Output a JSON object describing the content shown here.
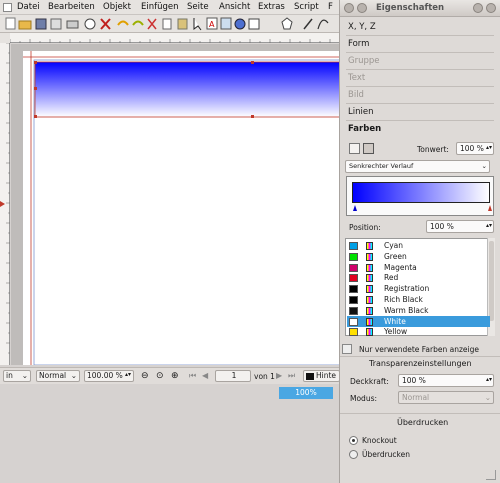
{
  "menu": {
    "items": [
      "Datei",
      "Bearbeiten",
      "Objekt",
      "Einfügen",
      "Seite",
      "Ansicht",
      "Extras",
      "Script",
      "F"
    ]
  },
  "bottom": {
    "unit": "in",
    "mode": "Normal",
    "zoom": "100.00 %",
    "page": "1",
    "of_pages": "von 1",
    "layer": "Hinte",
    "zoom_badge": "100%"
  },
  "panel": {
    "title": "Eigenschaften",
    "sections": {
      "xyz": "X, Y, Z",
      "form": "Form",
      "gruppe": "Gruppe",
      "text": "Text",
      "bild": "Bild",
      "linien": "Linien",
      "farben": "Farben"
    },
    "tonwert_label": "Tonwert:",
    "tonwert_value": "100 %",
    "gradient_type": "Senkrechter Verlauf",
    "position_label": "Position:",
    "position_value": "100 %",
    "colors": [
      {
        "name": "Cyan",
        "hex": "#00a0e6"
      },
      {
        "name": "Green",
        "hex": "#00e000"
      },
      {
        "name": "Magenta",
        "hex": "#d0006a"
      },
      {
        "name": "Red",
        "hex": "#e00020"
      },
      {
        "name": "Registration",
        "hex": "#000000"
      },
      {
        "name": "Rich Black",
        "hex": "#000000"
      },
      {
        "name": "Warm Black",
        "hex": "#111111"
      },
      {
        "name": "White",
        "hex": "#ffffff"
      },
      {
        "name": "Yellow",
        "hex": "#ffe000"
      }
    ],
    "selected_color": "White",
    "unused_label": "Nur verwendete Farben anzeige",
    "transparency_title": "Transparenzeinstellungen",
    "deckkraft_label": "Deckkraft:",
    "deckkraft_value": "100 %",
    "modus_label": "Modus:",
    "modus_value": "Normal",
    "overprint_title": "Überdrucken",
    "knockout_label": "Knockout",
    "overprint_label": "Überdrucken"
  },
  "colors": {
    "accent": "#3a9bdc",
    "gradient_start": "#0000ff",
    "gradient_end": "#ffffff",
    "frame": "#c0392b"
  }
}
